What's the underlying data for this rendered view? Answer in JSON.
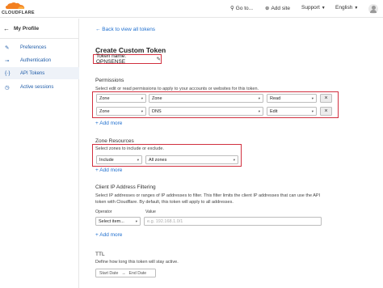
{
  "topbar": {
    "logo_text": "CLOUDFLARE",
    "goto_label": "Go to...",
    "add_site_label": "Add site",
    "support_label": "Support",
    "language_label": "English"
  },
  "sidebar": {
    "title": "My Profile",
    "items": [
      {
        "label": "Preferences",
        "icon": "pencil-icon"
      },
      {
        "label": "Authentication",
        "icon": "key-icon"
      },
      {
        "label": "API Tokens",
        "icon": "braces-icon"
      },
      {
        "label": "Active sessions",
        "icon": "clock-icon"
      }
    ],
    "active_index": 2
  },
  "main": {
    "back_link": "← Back to view all tokens",
    "title": "Create Custom Token",
    "token_name": "Token name: OPNSENSE",
    "permissions": {
      "title": "Permissions",
      "description": "Select edit or read permissions to apply to your accounts or websites for this token.",
      "rows": [
        {
          "scope": "Zone",
          "group": "Zone",
          "level": "Read"
        },
        {
          "scope": "Zone",
          "group": "DNS",
          "level": "Edit"
        }
      ],
      "add_more": "+ Add more"
    },
    "zone_resources": {
      "title": "Zone Resources",
      "description": "Select zones to include or exclude.",
      "include": "Include",
      "zones": "All zones",
      "add_more": "+ Add more"
    },
    "ip_filtering": {
      "title": "Client IP Address Filtering",
      "description_line1": "Select IP addresses or ranges of IP addresses to filter. This filter limits the client IP addresses that can use the API",
      "description_line2": "token with Cloudflare. By default, this token will apply to all addresses.",
      "operator_label": "Operator",
      "value_label": "Value",
      "operator_placeholder": "Select item...",
      "value_placeholder": "e.g. 192.168.1.0/1",
      "add_more": "+ Add more"
    },
    "ttl": {
      "title": "TTL",
      "description": "Define how long this token will stay active.",
      "start_date": "Start Date",
      "arrow": "→",
      "end_date": "End Date"
    }
  },
  "colors": {
    "accent_link": "#1f6fcf",
    "highlight_border": "#d1303f",
    "logo_orange": "#f38020"
  }
}
